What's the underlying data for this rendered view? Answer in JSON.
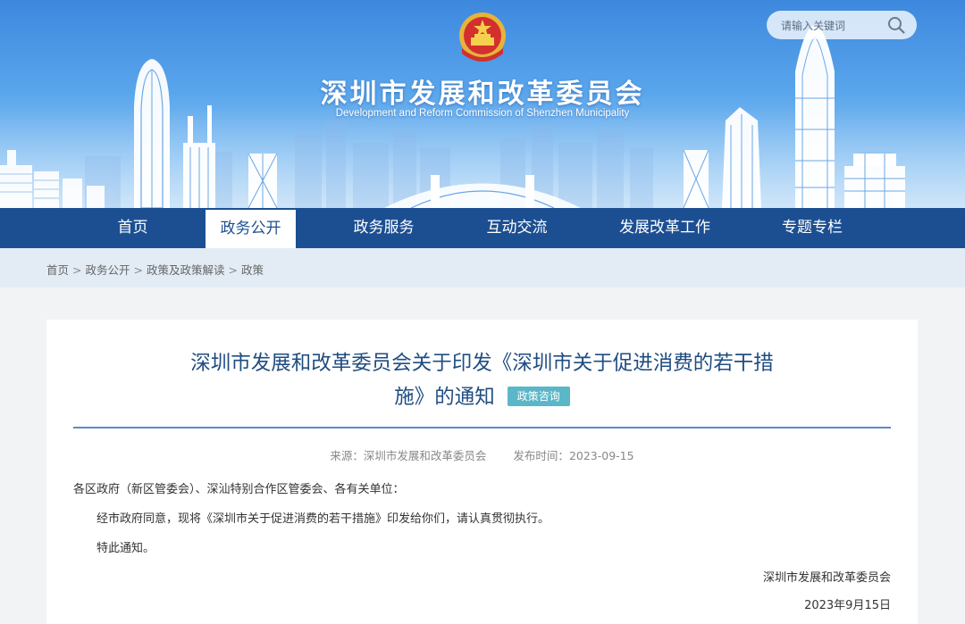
{
  "header": {
    "title": "深圳市发展和改革委员会",
    "subtitle": "Development and Reform Commission of Shenzhen Municipality",
    "emblem_icon": "national-emblem-icon",
    "search": {
      "placeholder": "请输入关键词",
      "icon": "search-icon"
    }
  },
  "nav": {
    "items": [
      {
        "label": "首页"
      },
      {
        "label": "政务公开",
        "active": true
      },
      {
        "label": "政务服务"
      },
      {
        "label": "互动交流"
      },
      {
        "label": "发展改革工作"
      },
      {
        "label": "专题专栏"
      }
    ]
  },
  "breadcrumb": {
    "items": [
      "首页",
      "政务公开",
      "政策及政策解读",
      "政策"
    ],
    "separator": ">"
  },
  "article": {
    "title_line1": "深圳市发展和改革委员会关于印发《深圳市关于促进消费的若干措",
    "title_line2": "施》的通知",
    "badge": "政策咨询",
    "source_label": "来源：",
    "source": "深圳市发展和改革委员会",
    "date_label": "发布时间：",
    "date": "2023-09-15",
    "salutation": "各区政府（新区管委会）、深汕特别合作区管委会、各有关单位：",
    "paragraph1": "经市政府同意，现将《深圳市关于促进消费的若干措施》印发给你们，请认真贯彻执行。",
    "paragraph2": "特此通知。",
    "signature": "深圳市发展和改革委员会",
    "signature_date": "2023年9月15日"
  },
  "colors": {
    "nav_bg": "#1c4f92",
    "title": "#1f4d82",
    "badge": "#5bb7c8",
    "rule": "#5a8cc4"
  }
}
